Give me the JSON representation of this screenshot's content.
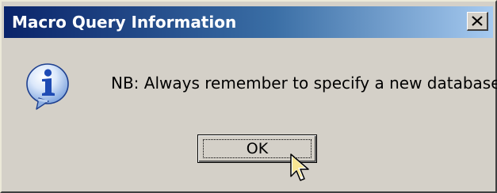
{
  "window": {
    "title": "Macro Query Information",
    "close_label": "X",
    "title_bar_color": "#0a246a",
    "background_color": "#d4d0c8"
  },
  "icon": {
    "name": "information-icon",
    "glyph": "i"
  },
  "message": {
    "text": "NB: Always remember to specify a new database!"
  },
  "buttons": {
    "ok_label": "OK"
  },
  "cursor": {
    "name": "arrow-pointer-cursor"
  }
}
